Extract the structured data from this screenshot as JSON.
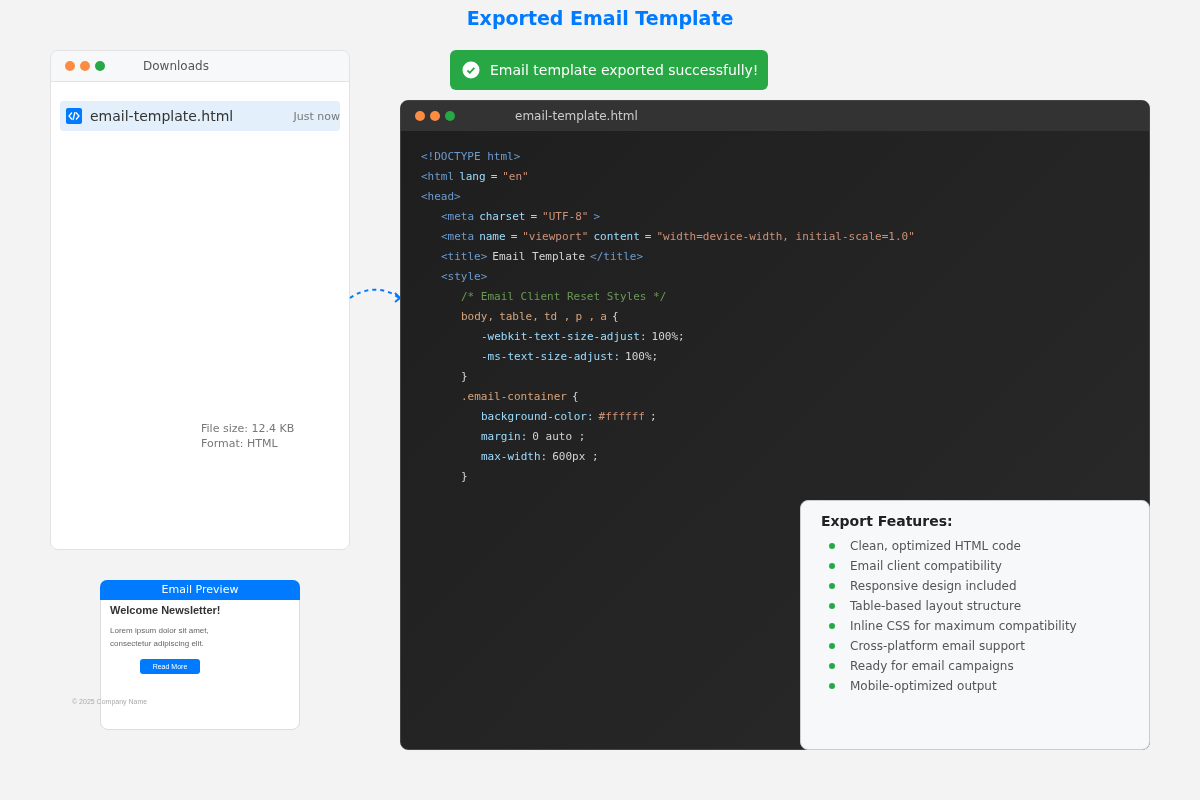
{
  "page_title": "Exported Email Template",
  "toast": {
    "text": "Email template exported successfully!"
  },
  "downloads": {
    "title": "Downloads",
    "items": [
      {
        "name": "email-template.html",
        "time": "Just now",
        "selected": true
      }
    ],
    "details": [
      "File size: 12.4 KB",
      "Format: HTML"
    ]
  },
  "preview": {
    "header": "Email Preview",
    "heading": "Welcome Newsletter!",
    "body": "Lorem ipsum dolor sit amet, consectetur adipiscing elit.",
    "button": "Read More",
    "footer": "© 2025 Company Name"
  },
  "editor": {
    "title": "email-template.html",
    "lines": [
      {
        "tokens": [
          {
            "kind": "tag",
            "text": "<!DOCTYPE html>"
          }
        ]
      },
      {
        "tokens": [
          {
            "kind": "tag",
            "text": "<html"
          },
          {
            "kind": "attr",
            "text": "lang"
          },
          {
            "kind": "punct",
            "text": "="
          },
          {
            "kind": "str",
            "text": "\"en\""
          }
        ]
      },
      {
        "tokens": [
          {
            "kind": "tag",
            "text": "<head>"
          }
        ],
        "children": [
          {
            "tokens": [
              {
                "kind": "tag",
                "text": "<meta"
              },
              {
                "kind": "attr",
                "text": "charset"
              },
              {
                "kind": "punct",
                "text": "="
              },
              {
                "kind": "str",
                "text": "\"UTF-8\""
              },
              {
                "kind": "tag",
                "text": ">"
              }
            ]
          },
          {
            "tokens": [
              {
                "kind": "tag",
                "text": "<meta"
              },
              {
                "kind": "attr",
                "text": "name"
              },
              {
                "kind": "punct",
                "text": "="
              },
              {
                "kind": "str",
                "text": "\"viewport\""
              },
              {
                "kind": "attr",
                "text": "content"
              },
              {
                "kind": "punct",
                "text": "="
              },
              {
                "kind": "str",
                "text": "\"width=device-width, initial-scale=1.0\""
              }
            ]
          },
          {
            "tokens": [
              {
                "kind": "tag",
                "text": "<title>"
              },
              {
                "kind": "text",
                "text": "Email Template"
              },
              {
                "kind": "tag",
                "text": "</title>"
              }
            ]
          },
          {
            "tokens": [
              {
                "kind": "tag",
                "text": "<style>"
              }
            ],
            "children": [
              {
                "tokens": [
                  {
                    "kind": "comment",
                    "text": "/* Email Client Reset Styles */"
                  }
                ]
              },
              {
                "tokens": [
                  {
                    "kind": "selector",
                    "text": "body,"
                  },
                  {
                    "kind": "selector",
                    "text": "table,"
                  },
                  {
                    "kind": "selector",
                    "text": "td ,"
                  },
                  {
                    "kind": "selector",
                    "text": "p ,"
                  },
                  {
                    "kind": "selector",
                    "text": "a"
                  },
                  {
                    "kind": "text",
                    "text": "{"
                  }
                ],
                "children": [
                  {
                    "tokens": [
                      {
                        "kind": "prop",
                        "text": "-webkit-text-size-adjust:"
                      },
                      {
                        "kind": "text",
                        "text": "100%;"
                      }
                    ]
                  },
                  {
                    "tokens": [
                      {
                        "kind": "prop",
                        "text": "-ms-text-size-adjust:"
                      },
                      {
                        "kind": "text",
                        "text": "100%;"
                      }
                    ]
                  }
                ]
              },
              {
                "tokens": [
                  {
                    "kind": "text",
                    "text": "}"
                  }
                ]
              },
              {
                "tokens": [
                  {
                    "kind": "selector",
                    "text": ".email-container"
                  },
                  {
                    "kind": "text",
                    "text": "{"
                  }
                ],
                "children": [
                  {
                    "tokens": [
                      {
                        "kind": "prop",
                        "text": "background-color:"
                      },
                      {
                        "kind": "str",
                        "text": "#ffffff"
                      },
                      {
                        "kind": "text",
                        "text": ";"
                      }
                    ]
                  },
                  {
                    "tokens": [
                      {
                        "kind": "prop",
                        "text": "margin:"
                      },
                      {
                        "kind": "text",
                        "text": "0 auto ;"
                      }
                    ]
                  },
                  {
                    "tokens": [
                      {
                        "kind": "prop",
                        "text": "max-width:"
                      },
                      {
                        "kind": "text",
                        "text": "600px ;"
                      }
                    ]
                  }
                ]
              },
              {
                "tokens": [
                  {
                    "kind": "text",
                    "text": "}"
                  }
                ]
              }
            ]
          }
        ]
      }
    ]
  },
  "features": {
    "title": "Export Features:",
    "items": [
      "Clean, optimized HTML code",
      "Email client compatibility",
      "Responsive design included",
      "Table-based layout structure",
      "Inline CSS for maximum compatibility",
      "Cross-platform email support",
      "Ready for email campaigns",
      "Mobile-optimized output"
    ]
  }
}
